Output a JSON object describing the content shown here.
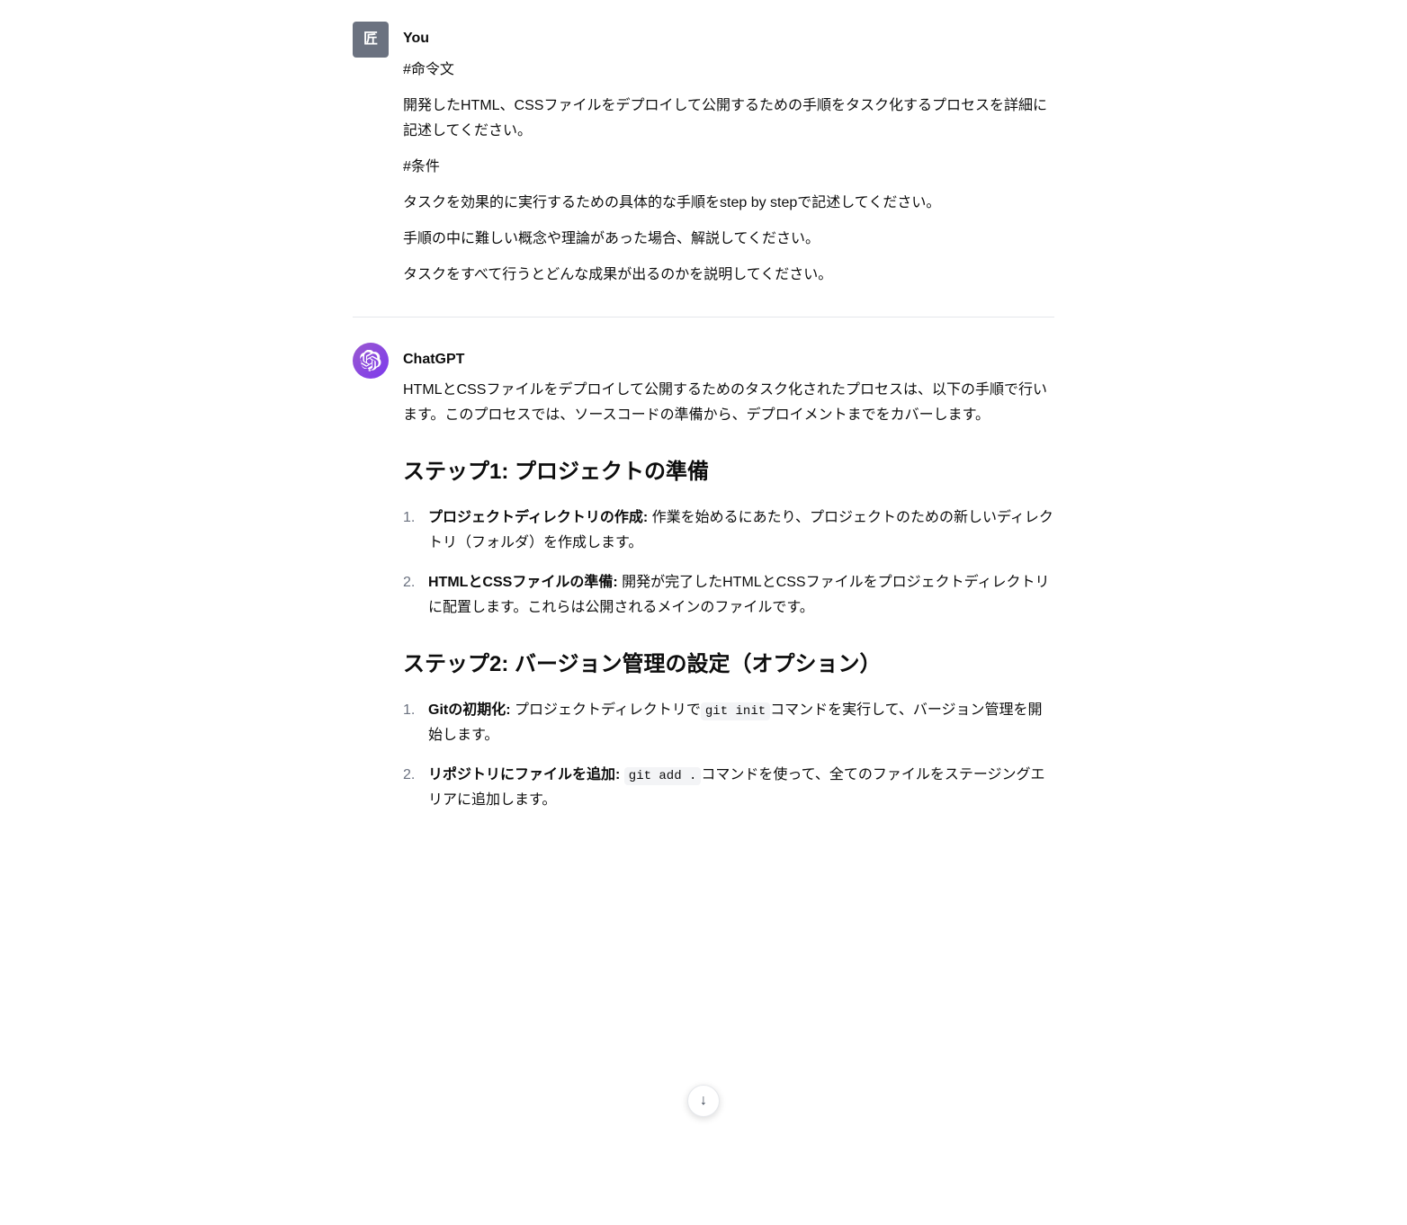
{
  "user": {
    "name": "You",
    "avatar_label": "匠",
    "message": {
      "heading": "#命令文",
      "body1": "開発したHTML、CSSファイルをデプロイして公開するための手順をタスク化するプロセスを詳細に記述してください。",
      "condition_heading": "#条件",
      "condition1": "タスクを効果的に実行するための具体的な手順をstep by stepで記述してください。",
      "condition2": "手順の中に難しい概念や理論があった場合、解説してください。",
      "condition3": "タスクをすべて行うとどんな成果が出るのかを説明してください。"
    }
  },
  "chatgpt": {
    "name": "ChatGPT",
    "intro": "HTMLとCSSファイルをデプロイして公開するためのタスク化されたプロセスは、以下の手順で行います。このプロセスでは、ソースコードの準備から、デプロイメントまでをカバーします。",
    "step1": {
      "title": "ステップ1: プロジェクトの準備",
      "items": [
        {
          "label": "プロジェクトディレクトリの作成:",
          "text": "作業を始めるにあたり、プロジェクトのための新しいディレクトリ（フォルダ）を作成します。"
        },
        {
          "label": "HTMLとCSSファイルの準備:",
          "text": "開発が完了したHTMLとCSSファイルをプロジェクトディレクトリに配置します。これらは公開されるメインのファイルです。"
        }
      ]
    },
    "step2": {
      "title": "ステップ2: バージョン管理の設定（オプション）",
      "items": [
        {
          "label": "Gitの初期化:",
          "text_prefix": "プロジェクトディレクトリで`",
          "code": "git init",
          "text_suffix": "`コマンドを実行して、バージョン管理を開始します。"
        },
        {
          "label": "リポジトリにファイルを追加:",
          "text_prefix": "`",
          "code": "git add .",
          "text_suffix": "`コマンドを使って、全てのファイルをステージングエリアに追加します。"
        }
      ]
    }
  },
  "scroll_down_icon": "↓",
  "colors": {
    "user_avatar_bg": "#6b7280",
    "chatgpt_avatar_bg": "#9b59d0",
    "accent": "#7c3aed"
  }
}
